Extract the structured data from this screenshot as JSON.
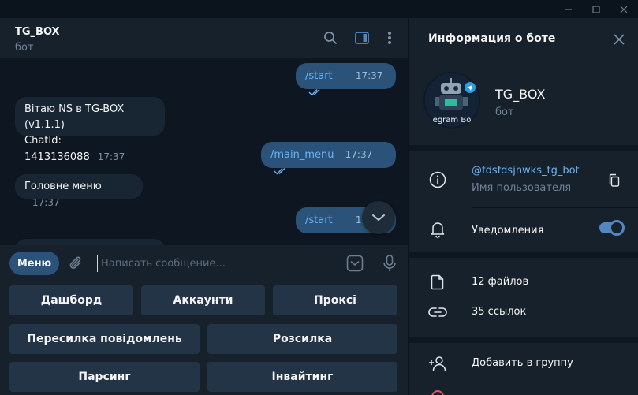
{
  "chat": {
    "title": "TG_BOX",
    "subtitle": "бот",
    "messages": [
      {
        "dir": "out",
        "text": "/start",
        "time": "17:37",
        "is_command": true
      },
      {
        "dir": "in",
        "line1": "Вітаю NS в TG-BOX (v1.1.1)",
        "line2": "ChatId: 1413136088",
        "time": "17:37"
      },
      {
        "dir": "out",
        "text": "/main_menu",
        "time": "17:37",
        "is_command": true
      },
      {
        "dir": "in",
        "text": "Головне меню",
        "time": "17:37"
      },
      {
        "dir": "out",
        "text": "/start",
        "time": "17:37",
        "is_command": true
      }
    ]
  },
  "composer": {
    "menu_label": "Меню",
    "placeholder": "Написать сообщение..."
  },
  "keyboard": {
    "rows": [
      [
        "Дашборд",
        "Аккаунти",
        "Проксі"
      ],
      [
        "Пересилка повідомлень",
        "Розсилка"
      ],
      [
        "Парсинг",
        "Інвайтинг"
      ]
    ]
  },
  "panel": {
    "title": "Информация о боте",
    "bot_name": "TG_BOX",
    "bot_sub": "бот",
    "avatar_caption": "egram Bo",
    "username": "@fdsfdsjnwks_tg_bot",
    "username_label": "Имя пользователя",
    "notifications_label": "Уведомления",
    "notifications_on": true,
    "files": "12 файлов",
    "links": "35 ссылок",
    "add_to_group": "Добавить в группу"
  },
  "colors": {
    "accent": "#5288c1",
    "link": "#6ab3f3",
    "outgoing_bubble": "#2b5278",
    "incoming_bubble": "#182533",
    "background": "#0e1621",
    "panel": "#17212b"
  },
  "icons": [
    "search-icon",
    "sidebar-toggle-icon",
    "more-vertical-icon",
    "close-icon",
    "minimize-icon",
    "maximize-icon",
    "attach-icon",
    "sticker-icon",
    "microphone-icon",
    "chevron-down-icon",
    "info-icon",
    "copy-icon",
    "bell-icon",
    "file-icon",
    "link-icon",
    "add-user-icon"
  ]
}
